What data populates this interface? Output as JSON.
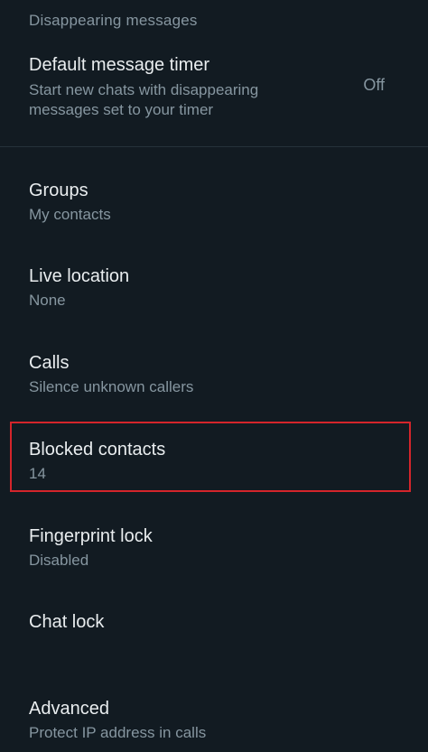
{
  "section_header": "Disappearing messages",
  "timer": {
    "title": "Default message timer",
    "subtitle": "Start new chats with disappearing messages set to your timer",
    "value": "Off"
  },
  "items": [
    {
      "title": "Groups",
      "subtitle": "My contacts"
    },
    {
      "title": "Live location",
      "subtitle": "None"
    },
    {
      "title": "Calls",
      "subtitle": "Silence unknown callers"
    },
    {
      "title": "Blocked contacts",
      "subtitle": "14"
    },
    {
      "title": "Fingerprint lock",
      "subtitle": "Disabled"
    },
    {
      "title": "Chat lock"
    },
    {
      "title": "Advanced",
      "subtitle": "Protect IP address in calls"
    }
  ],
  "colors": {
    "background": "#121b22",
    "primary_text": "#e9edef",
    "secondary_text": "#8696a0",
    "highlight": "#d4252b"
  }
}
